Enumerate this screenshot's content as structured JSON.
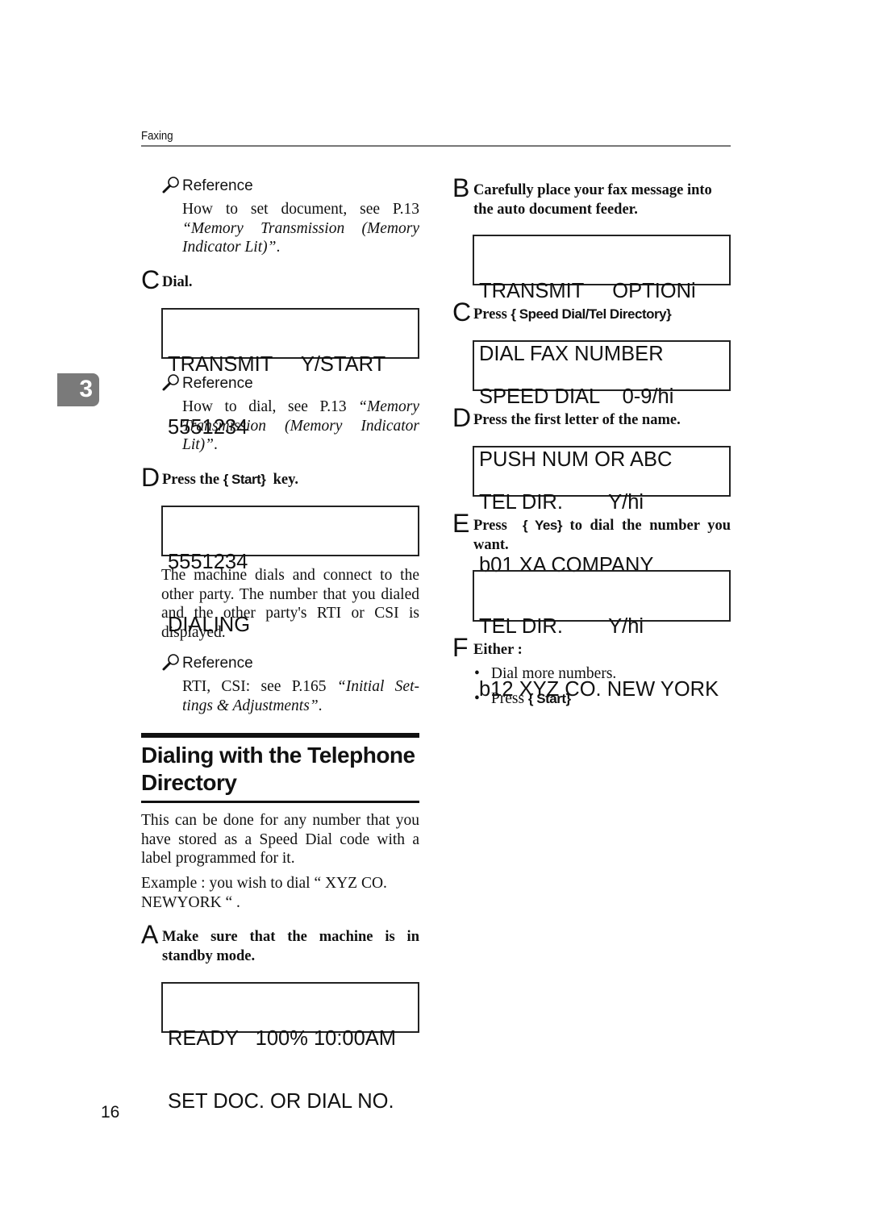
{
  "header": {
    "title": "Faxing"
  },
  "chapter_tab": {
    "number": "3"
  },
  "page_number": "16",
  "left": {
    "ref1": {
      "label": "Reference",
      "text_plain": "How to set document, see P.13",
      "text_italic": "“Memory Transmission (Memory Indicator Lit)”",
      "text_end": "."
    },
    "step_c": {
      "letter": "C",
      "text": "Dial."
    },
    "lcd1": {
      "line1": "TRANSMIT     Y/START",
      "line2": "5551234"
    },
    "ref2": {
      "label": "Reference",
      "text_plain": "How to dial, see P.13 ",
      "text_italic": "“Memory Transmission (Memory Indicator Lit)”",
      "text_end": "."
    },
    "step_d": {
      "letter": "D",
      "text_before": "Press the ",
      "key": "{ Start}",
      "text_after": "  key."
    },
    "lcd2": {
      "line1": "5551234",
      "line2": "DIALING"
    },
    "paragraph1": "The machine dials and connect to the other party. The number that you dialed and the other party's RTI or CSI is displayed.",
    "ref3": {
      "label": "Reference",
      "text_plain": "RTI, CSI: see P.165 ",
      "text_italic": "“Initial Set- tings & Adjustments”",
      "text_end": "."
    },
    "section_title": "Dialing with the Telephone Directory",
    "paragraph2": "This can be done for any number that you have stored as a Speed Dial code with a label programmed for it.",
    "paragraph3": "Example : you wish to dial “ XYZ CO. NEWYORK “ .",
    "step_a": {
      "letter": "A",
      "text": "Make sure that the machine is in standby mode."
    },
    "lcd3": {
      "line1": "READY   100% 10:00AM",
      "line2": "SET DOC. OR DIAL NO."
    }
  },
  "right": {
    "step_b": {
      "letter": "B",
      "text": "Carefully place your fax message into the auto document feeder."
    },
    "lcd1": {
      "line1": "TRANSMIT     OPTIONi",
      "line2": "DIAL FAX NUMBER"
    },
    "step_c": {
      "letter": "C",
      "text_before": "Press ",
      "key": "{ Speed Dial/Tel Directory}"
    },
    "lcd2": {
      "line1": "SPEED DIAL    0-9/hi",
      "line2": "PUSH NUM OR ABC"
    },
    "step_d": {
      "letter": "D",
      "text": "Press the first letter of the name."
    },
    "lcd3": {
      "line1": "TEL DIR.        Y/hi",
      "line2": "b01 XA COMPANY"
    },
    "step_e": {
      "letter": "E",
      "text_before": "Press  ",
      "key": "{ Yes}",
      "text_after": "  to dial the number you want."
    },
    "lcd4": {
      "line1": "TEL DIR.        Y/hi",
      "line2": "b12 XYZ CO. NEW YORK"
    },
    "step_f": {
      "letter": "F",
      "text": "Either :"
    },
    "bullets": [
      {
        "text": "Dial more numbers."
      },
      {
        "text_before": "Press ",
        "key": "{ Start}"
      }
    ]
  }
}
